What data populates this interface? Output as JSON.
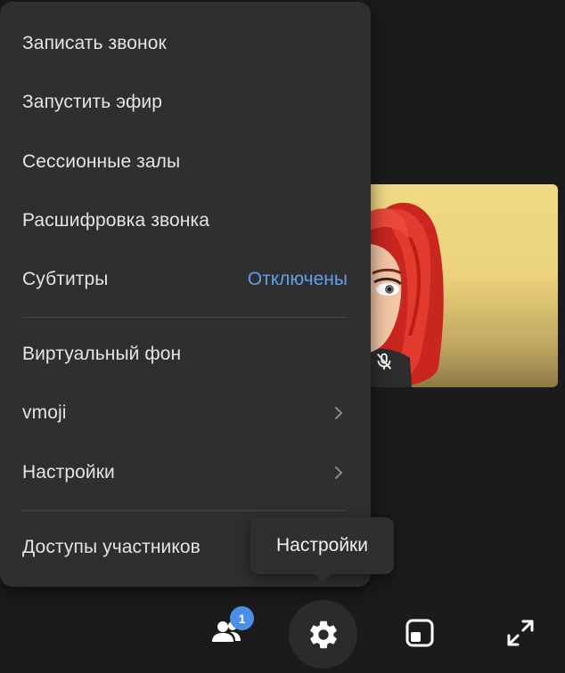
{
  "menu": {
    "items": [
      {
        "label": "Записать звонок"
      },
      {
        "label": "Запустить эфир"
      },
      {
        "label": "Сессионные залы"
      },
      {
        "label": "Расшифровка звонка"
      },
      {
        "label": "Субтитры",
        "value": "Отключены"
      },
      {
        "label": "Виртуальный фон"
      },
      {
        "label": "vmoji"
      },
      {
        "label": "Настройки"
      },
      {
        "label": "Доступы участников"
      }
    ]
  },
  "tooltip": {
    "label": "Настройки"
  },
  "controls": {
    "participants_badge": "1"
  },
  "icons": {
    "participants": "people-icon",
    "settings": "gear-icon",
    "layout": "layout-icon",
    "fullscreen": "expand-icon",
    "submenu": "chevron-right-icon",
    "mic": "mic-off-icon"
  },
  "colors": {
    "background": "#1b1b1b",
    "menu_bg": "#2f2f2f",
    "text": "#e4e4e4",
    "accent": "#5f9fea",
    "badge": "#4b8fe8",
    "tile_bg": "#f1d985"
  }
}
